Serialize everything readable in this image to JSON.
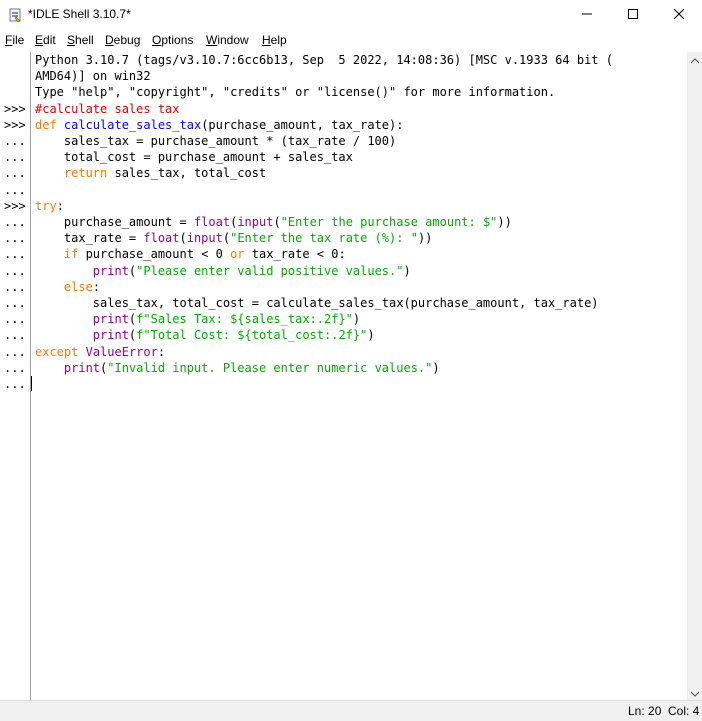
{
  "window": {
    "title": "*IDLE Shell 3.10.7*"
  },
  "menu": [
    "File",
    "Edit",
    "Shell",
    "Debug",
    "Options",
    "Window",
    "Help"
  ],
  "prompts": [
    "",
    "",
    "",
    ">>>",
    ">>>",
    "...",
    "...",
    "...",
    "...",
    ">>>",
    "...",
    "...",
    "...",
    "...",
    "...",
    "...",
    "...",
    "...",
    "...",
    "...",
    "..."
  ],
  "lines": [
    [
      {
        "t": "Python 3.10.7 (tags/v3.10.7:6cc6b13, Sep  5 2022, 14:08:36) [MSC v.1933 64 bit (",
        "c": "o"
      }
    ],
    [
      {
        "t": "AMD64)] on win32",
        "c": "o"
      }
    ],
    [
      {
        "t": "Type \"help\", \"copyright\", \"credits\" or \"license()\" for more information.",
        "c": "o"
      }
    ],
    [
      {
        "t": "#calculate sales tax",
        "c": "c"
      }
    ],
    [
      {
        "t": "def ",
        "c": "k"
      },
      {
        "t": "calculate_sales_tax",
        "c": "d"
      },
      {
        "t": "(purchase_amount, tax_rate):",
        "c": "o"
      }
    ],
    [
      {
        "t": "    sales_tax = purchase_amount * (tax_rate / 100)",
        "c": "o"
      }
    ],
    [
      {
        "t": "    total_cost = purchase_amount + sales_tax",
        "c": "o"
      }
    ],
    [
      {
        "t": "    ",
        "c": "o"
      },
      {
        "t": "return",
        "c": "k"
      },
      {
        "t": " sales_tax, total_cost",
        "c": "o"
      }
    ],
    [
      {
        "t": "",
        "c": "o"
      }
    ],
    [
      {
        "t": "try",
        "c": "k"
      },
      {
        "t": ":",
        "c": "o"
      }
    ],
    [
      {
        "t": "    purchase_amount = ",
        "c": "o"
      },
      {
        "t": "float",
        "c": "b"
      },
      {
        "t": "(",
        "c": "o"
      },
      {
        "t": "input",
        "c": "b"
      },
      {
        "t": "(",
        "c": "o"
      },
      {
        "t": "\"Enter the purchase amount: $\"",
        "c": "s"
      },
      {
        "t": "))",
        "c": "o"
      }
    ],
    [
      {
        "t": "    tax_rate = ",
        "c": "o"
      },
      {
        "t": "float",
        "c": "b"
      },
      {
        "t": "(",
        "c": "o"
      },
      {
        "t": "input",
        "c": "b"
      },
      {
        "t": "(",
        "c": "o"
      },
      {
        "t": "\"Enter the tax rate (%): \"",
        "c": "s"
      },
      {
        "t": "))",
        "c": "o"
      }
    ],
    [
      {
        "t": "    ",
        "c": "o"
      },
      {
        "t": "if",
        "c": "k"
      },
      {
        "t": " purchase_amount < 0 ",
        "c": "o"
      },
      {
        "t": "or",
        "c": "k"
      },
      {
        "t": " tax_rate < 0:",
        "c": "o"
      }
    ],
    [
      {
        "t": "        ",
        "c": "o"
      },
      {
        "t": "print",
        "c": "b"
      },
      {
        "t": "(",
        "c": "o"
      },
      {
        "t": "\"Please enter valid positive values.\"",
        "c": "s"
      },
      {
        "t": ")",
        "c": "o"
      }
    ],
    [
      {
        "t": "    ",
        "c": "o"
      },
      {
        "t": "else",
        "c": "k"
      },
      {
        "t": ":",
        "c": "o"
      }
    ],
    [
      {
        "t": "        sales_tax, total_cost = calculate_sales_tax(purchase_amount, tax_rate)",
        "c": "o"
      }
    ],
    [
      {
        "t": "        ",
        "c": "o"
      },
      {
        "t": "print",
        "c": "b"
      },
      {
        "t": "(",
        "c": "o"
      },
      {
        "t": "f\"Sales Tax: ${sales_tax:.2f}\"",
        "c": "s"
      },
      {
        "t": ")",
        "c": "o"
      }
    ],
    [
      {
        "t": "        ",
        "c": "o"
      },
      {
        "t": "print",
        "c": "b"
      },
      {
        "t": "(",
        "c": "o"
      },
      {
        "t": "f\"Total Cost: ${total_cost:.2f}\"",
        "c": "s"
      },
      {
        "t": ")",
        "c": "o"
      }
    ],
    [
      {
        "t": "except",
        "c": "k"
      },
      {
        "t": " ",
        "c": "o"
      },
      {
        "t": "ValueError",
        "c": "b"
      },
      {
        "t": ":",
        "c": "o"
      }
    ],
    [
      {
        "t": "    ",
        "c": "o"
      },
      {
        "t": "print",
        "c": "b"
      },
      {
        "t": "(",
        "c": "o"
      },
      {
        "t": "\"Invalid input. Please enter numeric values.\"",
        "c": "s"
      },
      {
        "t": ")",
        "c": "o"
      }
    ],
    [
      {
        "t": "    ",
        "c": "o"
      }
    ]
  ],
  "status": {
    "line": "Ln: 20",
    "col": "Col: 4"
  },
  "colors": {
    "keyword": "#ff7700",
    "builtin": "#900090",
    "string": "#00aa00",
    "comment": "#dd0000",
    "definition": "#0000ff"
  }
}
